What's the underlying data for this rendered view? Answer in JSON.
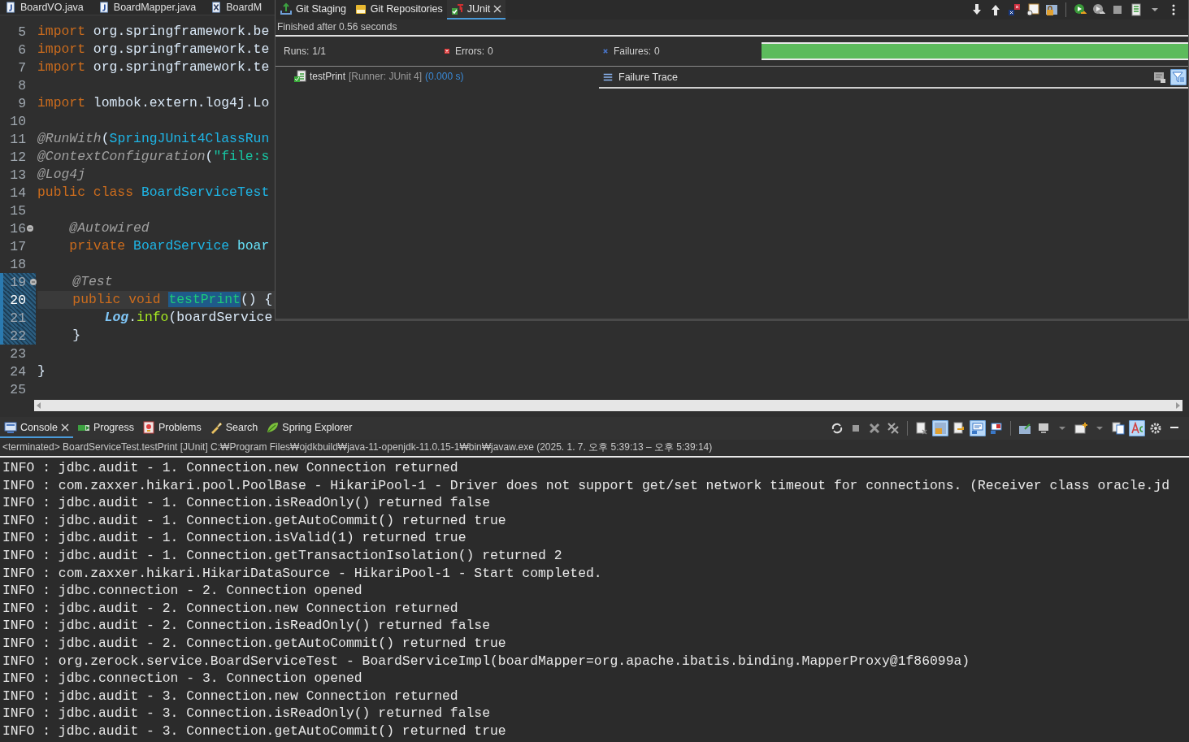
{
  "editor": {
    "tabs": [
      {
        "label": "BoardVO.java",
        "kind": "java"
      },
      {
        "label": "BoardMapper.java",
        "kind": "java"
      },
      {
        "label": "BoardM",
        "kind": "xml"
      }
    ],
    "lines": [
      {
        "number": "5",
        "fold_marker": false,
        "changed": false,
        "current": false,
        "tokens": [
          {
            "t": "import",
            "kind": "keyword"
          },
          {
            "t": " org.springframework.be",
            "kind": "plain"
          }
        ]
      },
      {
        "number": "6",
        "fold_marker": false,
        "changed": false,
        "current": false,
        "tokens": [
          {
            "t": "import",
            "kind": "keyword"
          },
          {
            "t": " org.springframework.te",
            "kind": "plain"
          }
        ]
      },
      {
        "number": "7",
        "fold_marker": false,
        "changed": false,
        "current": false,
        "tokens": [
          {
            "t": "import",
            "kind": "keyword"
          },
          {
            "t": " org.springframework.te",
            "kind": "plain"
          }
        ]
      },
      {
        "number": "8",
        "fold_marker": false,
        "changed": false,
        "current": false
      },
      {
        "number": "9",
        "fold_marker": false,
        "changed": false,
        "current": false,
        "tokens": [
          {
            "t": "import",
            "kind": "keyword"
          },
          {
            "t": " lombok.extern.log4j.Lo",
            "kind": "plain"
          }
        ]
      },
      {
        "number": "10",
        "fold_marker": false,
        "changed": false,
        "current": false
      },
      {
        "number": "11",
        "fold_marker": false,
        "changed": false,
        "current": false,
        "tokens": [
          {
            "t": "@RunWith",
            "kind": "annotation"
          },
          {
            "t": "(",
            "kind": "plain"
          },
          {
            "t": "SpringJUnit4ClassRun",
            "kind": "type"
          }
        ]
      },
      {
        "number": "12",
        "fold_marker": false,
        "changed": false,
        "current": false,
        "tokens": [
          {
            "t": "@ContextConfiguration",
            "kind": "annotation"
          },
          {
            "t": "(",
            "kind": "plain"
          },
          {
            "t": "\"file:s",
            "kind": "string"
          }
        ]
      },
      {
        "number": "13",
        "fold_marker": false,
        "changed": false,
        "current": false,
        "tokens": [
          {
            "t": "@Log4j",
            "kind": "annotation"
          }
        ]
      },
      {
        "number": "14",
        "fold_marker": false,
        "changed": false,
        "current": false,
        "tokens": [
          {
            "t": "public class",
            "kind": "keyword"
          },
          {
            "t": " BoardServiceTest",
            "kind": "type"
          }
        ]
      },
      {
        "number": "15",
        "fold_marker": false,
        "changed": false,
        "current": false
      },
      {
        "number": "16",
        "fold_marker": true,
        "changed": false,
        "current": false,
        "tokens": [
          {
            "t": "    @Autowired",
            "kind": "annotation"
          }
        ]
      },
      {
        "number": "17",
        "fold_marker": false,
        "changed": false,
        "current": false,
        "tokens": [
          {
            "t": "    private",
            "kind": "keyword"
          },
          {
            "t": " BoardService",
            "kind": "type"
          },
          {
            "t": " boar",
            "kind": "field"
          }
        ]
      },
      {
        "number": "18",
        "fold_marker": false,
        "changed": false,
        "current": false
      },
      {
        "number": "19",
        "fold_marker": true,
        "changed": true,
        "current": false,
        "tokens": [
          {
            "t": "    @Test",
            "kind": "annotation"
          }
        ]
      },
      {
        "number": "20",
        "fold_marker": false,
        "changed": true,
        "current": true,
        "tokens": [
          {
            "t": "    public void ",
            "kind": "keyword"
          },
          {
            "t": "testPrint",
            "kind": "selected"
          },
          {
            "t": "() {",
            "kind": "plain"
          }
        ]
      },
      {
        "number": "21",
        "fold_marker": false,
        "changed": true,
        "current": false,
        "tokens": [
          {
            "t": "        Log",
            "kind": "static"
          },
          {
            "t": ".",
            "kind": "plain"
          },
          {
            "t": "info",
            "kind": "method"
          },
          {
            "t": "(boardService",
            "kind": "plain"
          }
        ]
      },
      {
        "number": "22",
        "fold_marker": false,
        "changed": true,
        "current": false,
        "tokens": [
          {
            "t": "    }",
            "kind": "plain"
          }
        ]
      },
      {
        "number": "23",
        "fold_marker": false,
        "changed": false,
        "current": false
      },
      {
        "number": "24",
        "fold_marker": false,
        "changed": false,
        "current": false,
        "tokens": [
          {
            "t": "}",
            "kind": "plain"
          }
        ]
      },
      {
        "number": "25",
        "fold_marker": false,
        "changed": false,
        "current": false
      }
    ]
  },
  "junit": {
    "tabs": [
      {
        "label": "Git Staging",
        "kind": "staging",
        "selected": false,
        "closable": false
      },
      {
        "label": "Git Repositories",
        "kind": "repositories",
        "selected": false,
        "closable": false
      },
      {
        "label": "JUnit",
        "kind": "junit",
        "selected": true,
        "closable": true
      }
    ],
    "status": "Finished after 0.56 seconds",
    "counters": [
      {
        "label": "Runs:",
        "value": "1/1",
        "kind": "runs"
      },
      {
        "label": "Errors:",
        "value": "0",
        "kind": "errors"
      },
      {
        "label": "Failures:",
        "value": "0",
        "kind": "failures"
      }
    ],
    "progress": {
      "level": 1
    },
    "tests": [
      {
        "name": "testPrint",
        "runner": "[Runner: JUnit 4]",
        "time": "(0.000 s)"
      }
    ],
    "failure_trace": {
      "title": "Failure Trace"
    }
  },
  "console": {
    "tabs": [
      {
        "label": "Console",
        "kind": "console",
        "selected": true,
        "closable": true
      },
      {
        "label": "Progress",
        "kind": "progress",
        "selected": false,
        "closable": false
      },
      {
        "label": "Problems",
        "kind": "problems",
        "selected": false,
        "closable": false
      },
      {
        "label": "Search",
        "kind": "search",
        "selected": false,
        "closable": false
      },
      {
        "label": "Spring Explorer",
        "kind": "spring",
        "selected": false,
        "closable": false
      }
    ],
    "description": "<terminated> BoardServiceTest.testPrint [JUnit] C:₩Program Files₩ojdkbuild₩java-11-openjdk-11.0.15-1₩bin₩javaw.exe  (2025. 1. 7. 오후 5:39:13 – 오후 5:39:14)",
    "lines": [
      "INFO : jdbc.audit - 1. Connection.new Connection returned",
      "INFO : com.zaxxer.hikari.pool.PoolBase - HikariPool-1 - Driver does not support get/set network timeout for connections. (Receiver class oracle.jd",
      "INFO : jdbc.audit - 1. Connection.isReadOnly() returned false",
      "INFO : jdbc.audit - 1. Connection.getAutoCommit() returned true",
      "INFO : jdbc.audit - 1. Connection.isValid(1) returned true",
      "INFO : jdbc.audit - 1. Connection.getTransactionIsolation() returned 2",
      "INFO : com.zaxxer.hikari.HikariDataSource - HikariPool-1 - Start completed.",
      "INFO : jdbc.connection - 2. Connection opened",
      "INFO : jdbc.audit - 2. Connection.new Connection returned",
      "INFO : jdbc.audit - 2. Connection.isReadOnly() returned false",
      "INFO : jdbc.audit - 2. Connection.getAutoCommit() returned true",
      "INFO : org.zerock.service.BoardServiceTest - BoardServiceImpl(boardMapper=org.apache.ibatis.binding.MapperProxy@1f86099a)",
      "INFO : jdbc.connection - 3. Connection opened",
      "INFO : jdbc.audit - 3. Connection.new Connection returned",
      "INFO : jdbc.audit - 3. Connection.isReadOnly() returned false",
      "INFO : jdbc.audit - 3. Connection.getAutoCommit() returned true"
    ]
  }
}
